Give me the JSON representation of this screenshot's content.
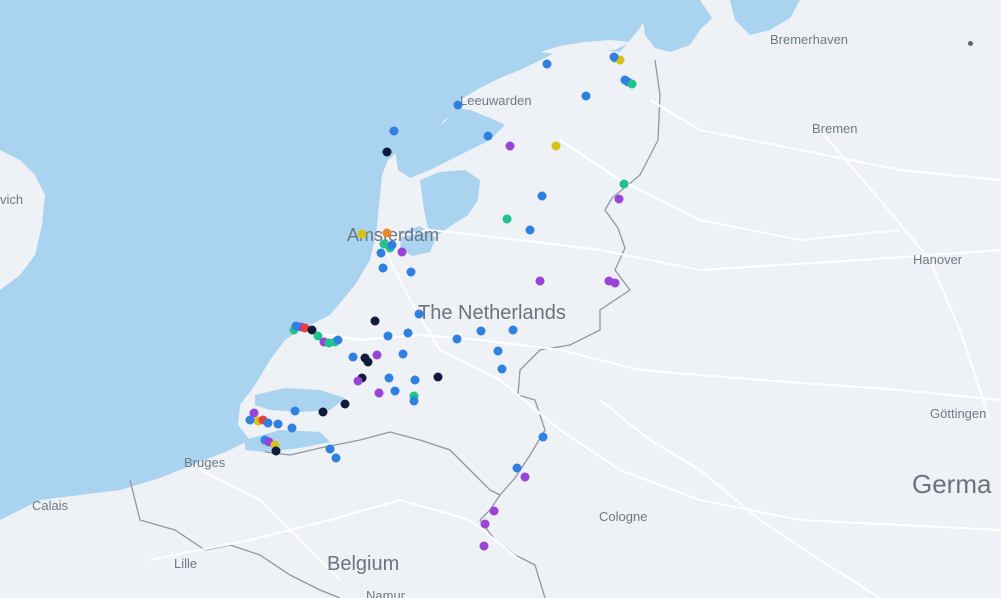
{
  "map": {
    "colors": {
      "water": "#a9d3ef",
      "land": "#eef1f5",
      "border": "#8f98a3",
      "road": "#ffffff"
    },
    "labels": {
      "bremerhaven": "Bremerhaven",
      "leeuwarden": "Leeuwarden",
      "bremen": "Bremen",
      "ipswich_partial": "vich",
      "amsterdam": "Amsterdam",
      "hanover": "Hanover",
      "the_netherlands": "The Netherlands",
      "gottingen": "Göttingen",
      "bruges": "Bruges",
      "germany_partial": "Germa",
      "calais": "Calais",
      "cologne": "Cologne",
      "lille": "Lille",
      "belgium": "Belgium",
      "namur_partial": "Namur"
    },
    "marker_colors": {
      "blue": "#2f80e0",
      "purple": "#9a43d8",
      "navy": "#0f1a3c",
      "green": "#22c38a",
      "yellow": "#d6c11a",
      "orange": "#e88a2a",
      "red": "#e04040"
    }
  }
}
